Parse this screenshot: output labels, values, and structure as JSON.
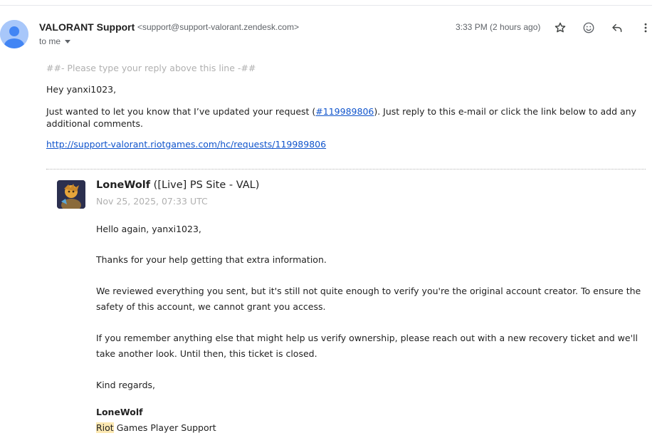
{
  "email": {
    "sender_name": "VALORANT Support",
    "sender_email": "<support@support-valorant.zendesk.com>",
    "recipient": "to me",
    "timestamp": "3:33 PM (2 hours ago)"
  },
  "icons": {
    "avatar": "person-icon",
    "star": "star-icon",
    "emoji": "emoji-icon",
    "reply": "reply-icon",
    "more": "more-vertical-icon",
    "caret": "chevron-down-icon"
  },
  "body": {
    "reply_line": "##- Please type your reply above this line -##",
    "greeting": "Hey yanxi1023,",
    "intro_before": "Just wanted to let you know that I’ve updated your request (",
    "request_link": "#119989806",
    "intro_after": "). Just reply to this e-mail or click the link below to add any additional comments.",
    "url": "http://support-valorant.riotgames.com/hc/requests/119989806"
  },
  "comment": {
    "agent_name": "LoneWolf",
    "agent_role": " ([Live] PS Site - VAL)",
    "date": "Nov 25, 2025, 07:33 UTC",
    "paragraphs": [
      "Hello again, yanxi1023,",
      "Thanks for your help getting that extra information.",
      "We reviewed everything you sent, but it's still not quite enough to verify you're the original account creator. To ensure the safety of this account, we cannot grant you access.",
      "If you remember anything else that might help us verify ownership, please reach out with a new recovery ticket and we'll take another look. Until then, this ticket is closed.",
      "Kind regards,"
    ],
    "signature_name": "LoneWolf",
    "signature_highlight": "Riot",
    "signature_team": " Games Player Support"
  },
  "colors": {
    "link": "#1155cc",
    "avatar_bg": "#a8c7fa",
    "avatar_fg": "#4285f4",
    "highlight": "#fce8b2",
    "muted": "#b0b0b0"
  }
}
